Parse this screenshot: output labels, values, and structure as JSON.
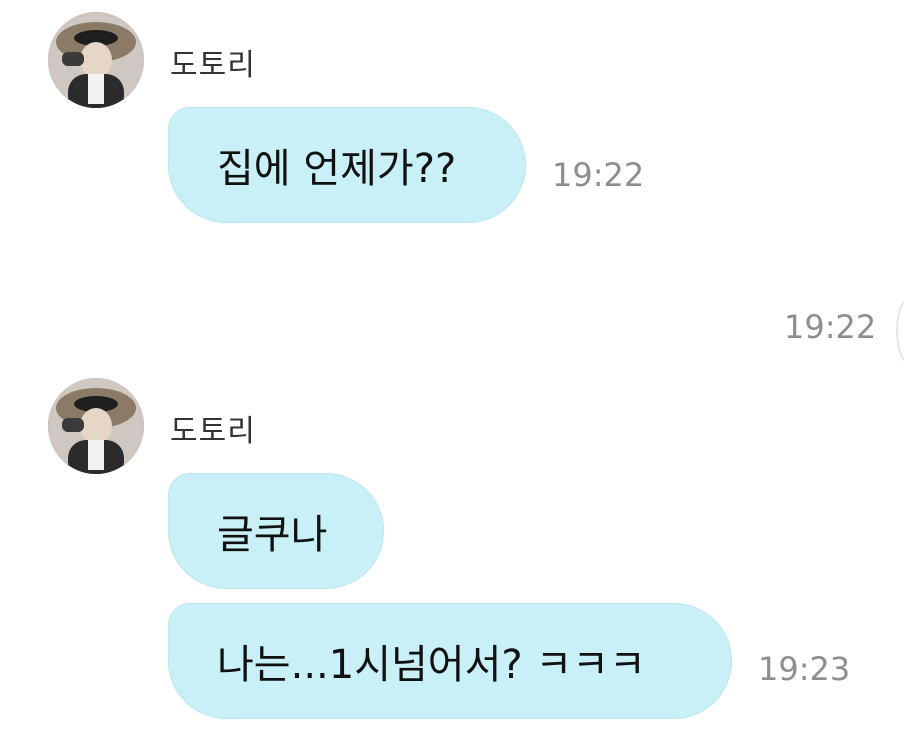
{
  "messages": [
    {
      "sender": "도토리",
      "avatar_icon": "profile-photo",
      "bubbles": [
        {
          "text": "집에 언제가??",
          "time": "19:22"
        }
      ]
    },
    {
      "outgoing_time": "19:22"
    },
    {
      "sender": "도토리",
      "avatar_icon": "profile-photo",
      "bubbles": [
        {
          "text": "글쿠나",
          "time": ""
        },
        {
          "text": "나는...1시넘어서? ㅋㅋㅋ",
          "time": "19:23"
        }
      ]
    }
  ],
  "colors": {
    "bubble": "#c8f0f6",
    "time": "#8e8e8e",
    "name": "#333333"
  }
}
